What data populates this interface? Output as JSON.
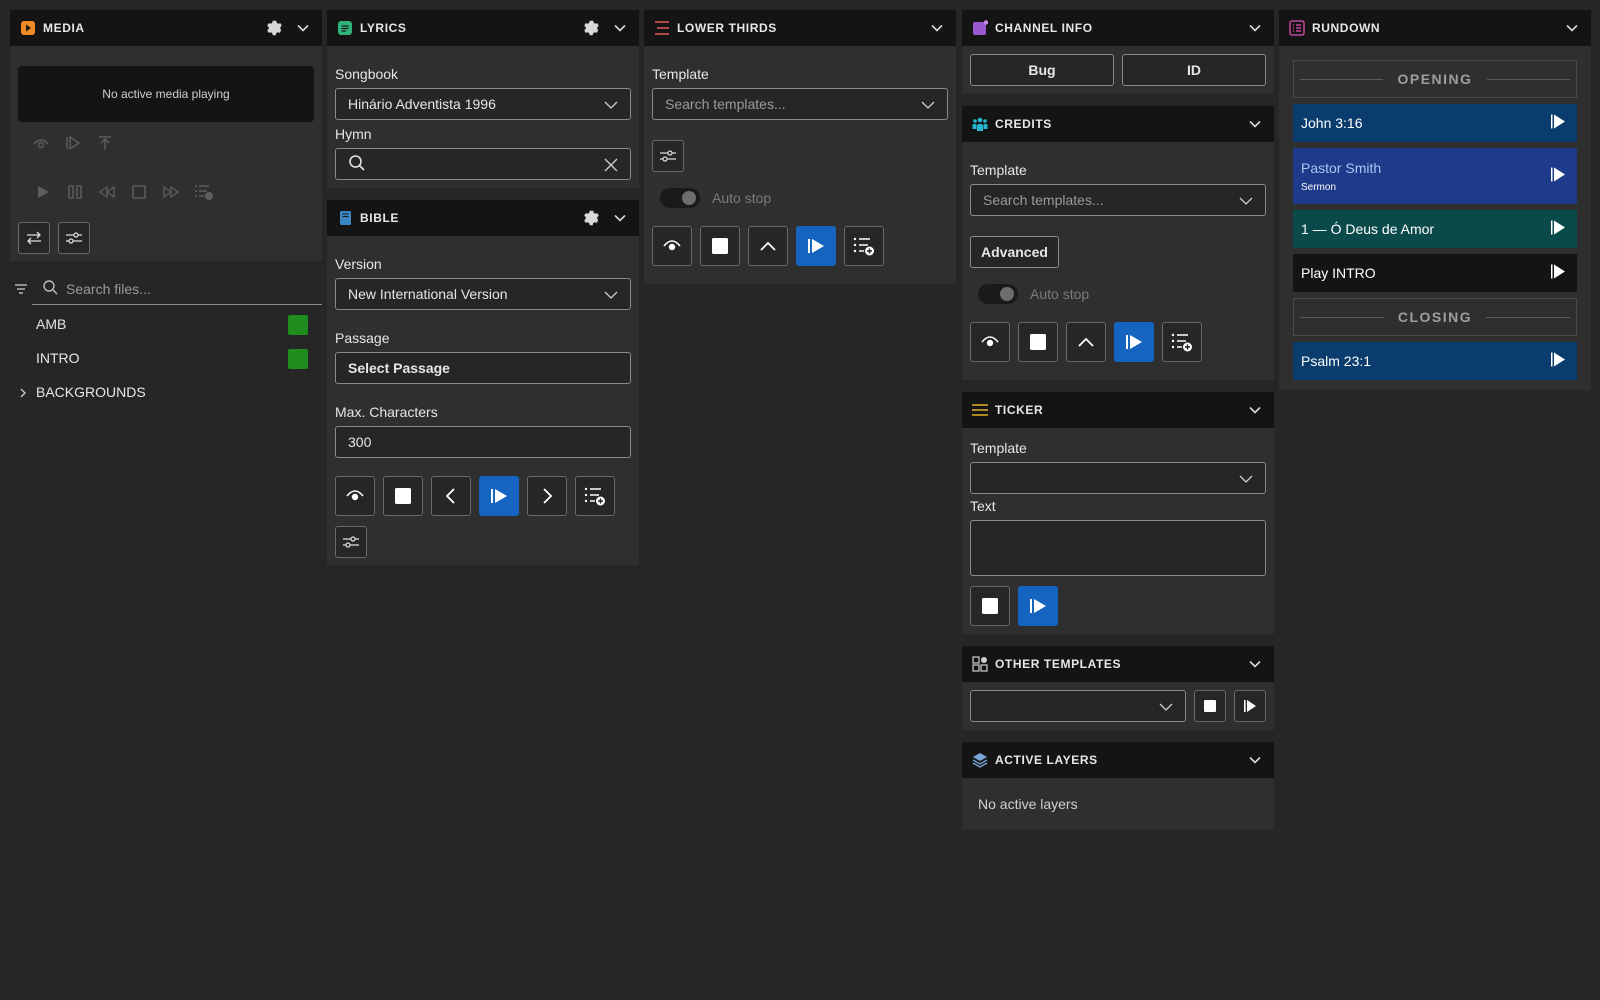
{
  "media": {
    "title": "MEDIA",
    "status": "No active media playing",
    "search_placeholder": "Search files...",
    "files": [
      {
        "name": "AMB",
        "color": "#1f8e1f"
      },
      {
        "name": "INTRO",
        "color": "#1f8e1f"
      }
    ],
    "folder": "BACKGROUNDS"
  },
  "lyrics": {
    "title": "LYRICS",
    "songbook_label": "Songbook",
    "songbook_value": "Hinário Adventista 1996",
    "hymn_label": "Hymn",
    "hymn_value": ""
  },
  "bible": {
    "title": "BIBLE",
    "version_label": "Version",
    "version_value": "New International Version",
    "passage_label": "Passage",
    "passage_button": "Select Passage",
    "max_label": "Max. Characters",
    "max_value": "300"
  },
  "lower_thirds": {
    "title": "LOWER THIRDS",
    "template_label": "Template",
    "template_placeholder": "Search templates...",
    "auto_stop": "Auto stop"
  },
  "channel_info": {
    "title": "CHANNEL INFO",
    "bug_button": "Bug",
    "id_button": "ID"
  },
  "credits": {
    "title": "CREDITS",
    "template_label": "Template",
    "template_placeholder": "Search templates...",
    "advanced_button": "Advanced",
    "auto_stop": "Auto stop"
  },
  "ticker": {
    "title": "TICKER",
    "template_label": "Template",
    "text_label": "Text"
  },
  "other_templates": {
    "title": "OTHER TEMPLATES"
  },
  "active_layers": {
    "title": "ACTIVE LAYERS",
    "empty": "No active layers"
  },
  "rundown": {
    "title": "RUNDOWN",
    "items": [
      {
        "type": "separator",
        "label": "OPENING"
      },
      {
        "type": "item",
        "label": "John 3:16",
        "sub": "",
        "color": "#0a3d6e"
      },
      {
        "type": "item",
        "label": "Pastor Smith",
        "sub": "Sermon",
        "color": "#1e3a8a"
      },
      {
        "type": "item",
        "label": "1 — Ó Deus de Amor",
        "sub": "",
        "color": "#0b4a4a"
      },
      {
        "type": "item",
        "label": "Play INTRO",
        "sub": "",
        "color": "#141414"
      },
      {
        "type": "separator",
        "label": "CLOSING"
      },
      {
        "type": "item",
        "label": "Psalm 23:1",
        "sub": "",
        "color": "#0a3d6e"
      }
    ]
  },
  "colors": {
    "accent_blue": "#1565c0",
    "media_icon": "#f08a24",
    "lyrics_icon": "#2fb37c",
    "bible_icon": "#3d86c6",
    "lower_thirds_icon": "#e05a5a",
    "channel_icon": "#9b59d0",
    "credits_icon": "#29b6d0",
    "ticker_icon": "#e0b028",
    "rundown_icon": "#c24aa0"
  }
}
